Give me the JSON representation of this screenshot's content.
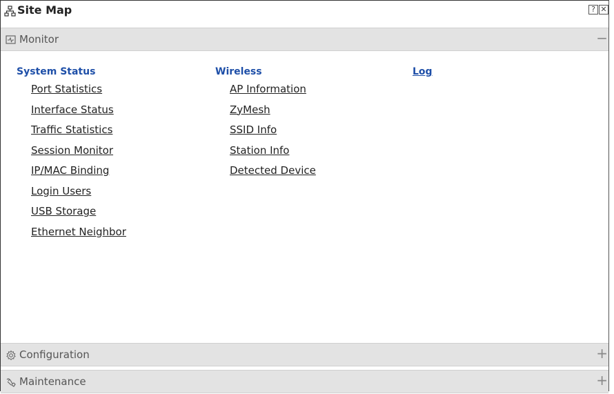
{
  "window": {
    "title": "Site Map",
    "help_label": "?",
    "close_label": "✕"
  },
  "sections": {
    "monitor": {
      "label": "Monitor",
      "toggle": "−"
    },
    "configuration": {
      "label": "Configuration",
      "toggle": "+"
    },
    "maintenance": {
      "label": "Maintenance",
      "toggle": "+"
    }
  },
  "monitor": {
    "system_status": {
      "title": "System Status",
      "items": [
        "Port Statistics",
        "Interface Status",
        "Traffic Statistics",
        "Session Monitor",
        "IP/MAC Binding",
        "Login Users",
        "USB Storage",
        "Ethernet Neighbor"
      ]
    },
    "wireless": {
      "title": "Wireless",
      "items": [
        "AP Information",
        "ZyMesh",
        "SSID Info",
        "Station Info",
        "Detected Device"
      ]
    },
    "log": {
      "title": "Log"
    }
  },
  "colors": {
    "category_title": "#1e4fa8",
    "section_header_bg": "#e3e3e3",
    "link_text": "#222222"
  }
}
